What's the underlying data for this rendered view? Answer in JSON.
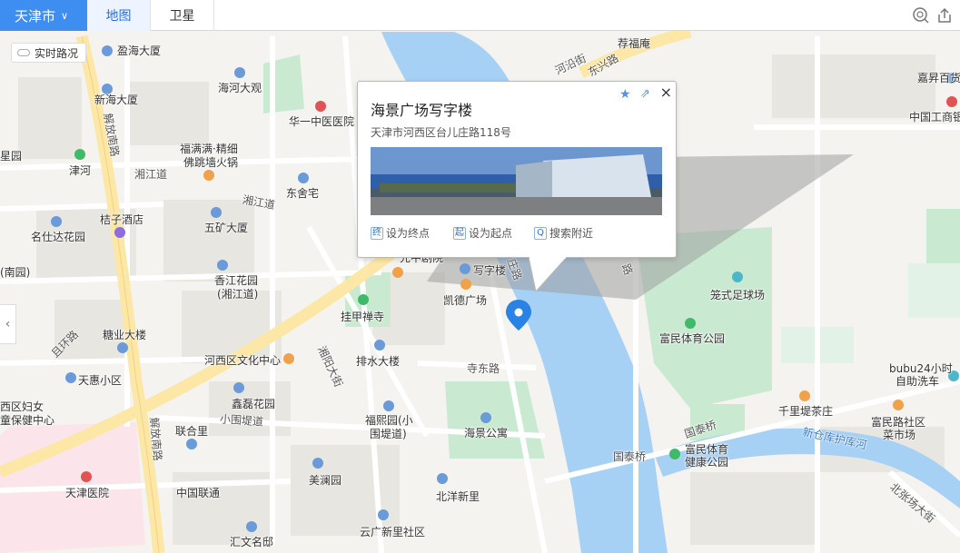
{
  "toolbar": {
    "city": "天津市",
    "tabs": [
      {
        "label": "地图",
        "active": true
      },
      {
        "label": "卫星",
        "active": false
      }
    ],
    "tools": [
      "location-search-icon",
      "share-icon"
    ]
  },
  "traffic_button": "实时路况",
  "popup": {
    "title": "海景广场写字楼",
    "address": "天津市河西区台儿庄路118号",
    "actions": [
      {
        "badge": "终",
        "label": "设为终点"
      },
      {
        "badge": "起",
        "label": "设为起点"
      },
      {
        "badge": "Q",
        "label": "搜索附近"
      }
    ],
    "close": "×",
    "star": "★"
  },
  "map": {
    "colors": {
      "land": "#f4f3ef",
      "road": "#ffffff",
      "major_road": "#fce7a7",
      "water": "#a7d0f5",
      "park": "#c9ead1",
      "hospital_zone": "#fbe4ea",
      "blocks": "#e8e6e1",
      "pin": "#2a82e4"
    },
    "pois": [
      {
        "name": "盈海大厦"
      },
      {
        "name": "荐福庵"
      },
      {
        "name": "新海大厦"
      },
      {
        "name": "海河大观"
      },
      {
        "name": "华一中医医院"
      },
      {
        "name": "嘉昇百货"
      },
      {
        "name": "中国工商银"
      },
      {
        "name": "福满满·精细"
      },
      {
        "name": "佛跳墙火锅"
      },
      {
        "name": "津河"
      },
      {
        "name": "东舍宅"
      },
      {
        "name": "五矿大厦"
      },
      {
        "name": "名仕达花园"
      },
      {
        "name": "桔子酒店"
      },
      {
        "name": "香江花园"
      },
      {
        "name": "(湘江道)"
      },
      {
        "name": "写字楼"
      },
      {
        "name": "凯德广场"
      },
      {
        "name": "挂甲禅寺"
      },
      {
        "name": "笼式足球场"
      },
      {
        "name": "富民体育公园"
      },
      {
        "name": "糖业大楼"
      },
      {
        "name": "排水大楼"
      },
      {
        "name": "天惠小区"
      },
      {
        "name": "河西区文化中心"
      },
      {
        "name": "鑫磊花园"
      },
      {
        "name": "福熙园(小"
      },
      {
        "name": "围堤道)"
      },
      {
        "name": "海景公寓"
      },
      {
        "name": "千里堤茶庄"
      },
      {
        "name": "富民路社区"
      },
      {
        "name": "菜市场"
      },
      {
        "name": "bubu24小时"
      },
      {
        "name": "自助洗车"
      },
      {
        "name": "联合里"
      },
      {
        "name": "美澜园"
      },
      {
        "name": "天津医院"
      },
      {
        "name": "中国联通"
      },
      {
        "name": "北洋新里"
      },
      {
        "name": "富民体育"
      },
      {
        "name": "健康公园"
      },
      {
        "name": "云广新里社区"
      },
      {
        "name": "汇文名邸"
      },
      {
        "name": "西区妇女"
      },
      {
        "name": "童保健中心"
      },
      {
        "name": "(南园)"
      },
      {
        "name": "星园"
      },
      {
        "name": "先中剧院"
      }
    ],
    "roads": [
      {
        "name": "河沿街"
      },
      {
        "name": "东兴路"
      },
      {
        "name": "解放南路"
      },
      {
        "name": "湘江道"
      },
      {
        "name": "湘江道"
      },
      {
        "name": "且环路"
      },
      {
        "name": "湘阳大街"
      },
      {
        "name": "寺东路"
      },
      {
        "name": "小围堤道"
      },
      {
        "name": "国泰桥"
      },
      {
        "name": "国泰桥"
      },
      {
        "name": "新仓库护库河"
      },
      {
        "name": "北张场大街"
      },
      {
        "name": "解放南路"
      },
      {
        "name": "庄路"
      },
      {
        "name": "路"
      }
    ]
  }
}
